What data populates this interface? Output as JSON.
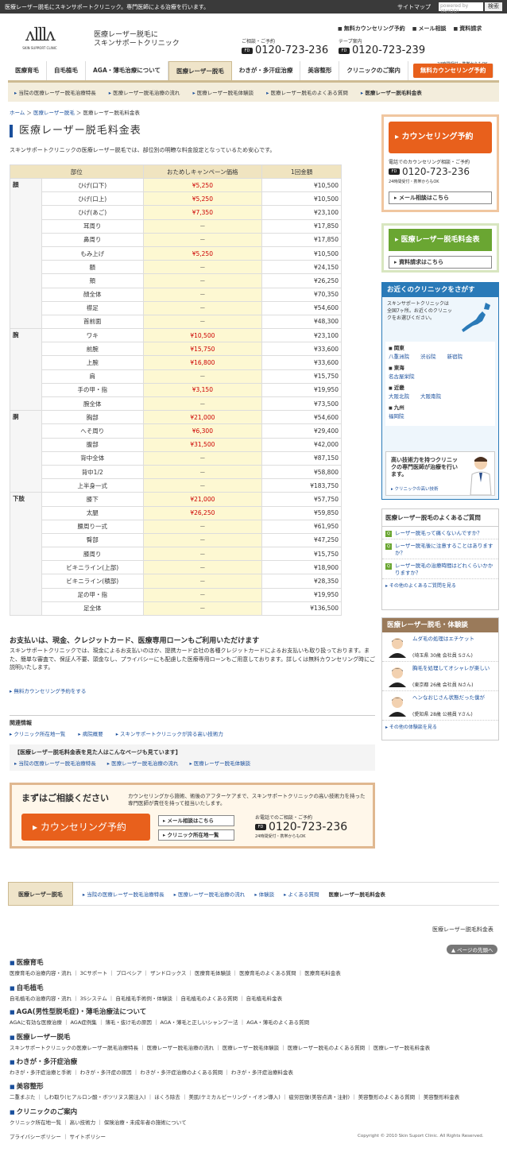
{
  "topbar": {
    "tagline": "医療レーザー脱毛にスキンサポートクリニック。専門医師による治療を行います。",
    "sitemap": "サイトマップ",
    "search_placeholder": "powered by YAHOO!",
    "search_btn": "検索"
  },
  "header": {
    "logo_sub": "SKIN SUPPORT CLINIC",
    "title_line1": "医療レーザー脱毛に",
    "title_line2": "スキンサポートクリニック",
    "links": [
      "無料カウンセリング予約",
      "メール相談",
      "資料請求"
    ],
    "phone1_label": "ご相談・ご予約",
    "phone1": "0120-723-236",
    "phone2_label": "テープ案内",
    "phone2": "0120-723-239",
    "hours": "24時間受付・携帯からもOK",
    "freedial": "FD"
  },
  "gnav": [
    "医療育毛",
    "自毛植毛",
    "AGA・薄毛治療について",
    "医療レーザー脱毛",
    "わきが・多汗症治療",
    "美容整形",
    "クリニックのご案内"
  ],
  "gnav_cta": "無料カウンセリング予約",
  "subnav": [
    "当院の医療レーザー脱毛治療特長",
    "医療レーザー脱毛治療の流れ",
    "医療レーザー脱毛体験談",
    "医療レーザー脱毛のよくある質問",
    "医療レーザー脱毛料金表"
  ],
  "breadcrumb": {
    "home": "ホーム",
    "parent": "医療レーザー脱毛",
    "current": "医療レーザー脱毛料金表"
  },
  "page_title": "医療レーザー脱毛料金表",
  "intro": "スキンサポートクリニックの医療レーザー脱毛では、部位別の明瞭な料金設定となっているため安心です。",
  "table": {
    "headers": [
      "部位",
      "おためしキャンペーン価格",
      "1回金額"
    ],
    "groups": [
      {
        "cat": "顔",
        "rows": [
          [
            "ひげ(口下)",
            "¥5,250",
            "¥10,500"
          ],
          [
            "ひげ(口上)",
            "¥5,250",
            "¥10,500"
          ],
          [
            "ひげ(あご)",
            "¥7,350",
            "¥23,100"
          ],
          [
            "耳周り",
            "－",
            "¥17,850"
          ],
          [
            "鼻周り",
            "－",
            "¥17,850"
          ],
          [
            "もみ上げ",
            "¥5,250",
            "¥10,500"
          ],
          [
            "額",
            "－",
            "¥24,150"
          ],
          [
            "頬",
            "－",
            "¥26,250"
          ],
          [
            "顔全体",
            "－",
            "¥70,350"
          ],
          [
            "襟足",
            "－",
            "¥54,600"
          ],
          [
            "首前面",
            "－",
            "¥48,300"
          ]
        ]
      },
      {
        "cat": "腕",
        "rows": [
          [
            "ワキ",
            "¥10,500",
            "¥23,100"
          ],
          [
            "前腕",
            "¥15,750",
            "¥33,600"
          ],
          [
            "上腕",
            "¥16,800",
            "¥33,600"
          ],
          [
            "肩",
            "－",
            "¥15,750"
          ],
          [
            "手の甲・指",
            "¥3,150",
            "¥19,950"
          ],
          [
            "腕全体",
            "－",
            "¥73,500"
          ]
        ]
      },
      {
        "cat": "胴",
        "rows": [
          [
            "胸部",
            "¥21,000",
            "¥54,600"
          ],
          [
            "へそ周り",
            "¥6,300",
            "¥29,400"
          ],
          [
            "腹部",
            "¥31,500",
            "¥42,000"
          ],
          [
            "背中全体",
            "－",
            "¥87,150"
          ],
          [
            "背中1/2",
            "－",
            "¥58,800"
          ],
          [
            "上半身一式",
            "－",
            "¥183,750"
          ]
        ]
      },
      {
        "cat": "下肢",
        "rows": [
          [
            "膝下",
            "¥21,000",
            "¥57,750"
          ],
          [
            "太腿",
            "¥26,250",
            "¥59,850"
          ],
          [
            "腰周り一式",
            "－",
            "¥61,950"
          ],
          [
            "臀部",
            "－",
            "¥47,250"
          ],
          [
            "膝周り",
            "－",
            "¥15,750"
          ],
          [
            "ビキニライン(上部)",
            "－",
            "¥18,900"
          ],
          [
            "ビキニライン(積部)",
            "－",
            "¥28,350"
          ],
          [
            "足の甲・指",
            "－",
            "¥19,950"
          ],
          [
            "足全体",
            "－",
            "¥136,500"
          ]
        ]
      }
    ]
  },
  "payment": {
    "heading": "お支払いは、現金、クレジットカード、医療専用ローンもご利用いただけます",
    "text": "スキンサポートクリニックでは、現金によるお支払いのほか、提携カード会社の各種クレジットカードによるお支払いも取り扱っております。また、簡単な審査で、保証人不要、頭金なし、プライバシーにも配慮した医療専用ローンもご用意しております。詳しくは無料カウンセリング時にご説明いたします。",
    "link": "無料カウンセリング予約をする"
  },
  "related": {
    "title": "関連情報",
    "links": [
      "クリニック所在地一覧",
      "病院概要",
      "スキンサポートクリニックが誇る高い技術力"
    ]
  },
  "related2": {
    "title": "【医療レーザー脱毛料金表を見た人はこんなページも見ています】",
    "links": [
      "当院の医療レーザー脱毛治療特長",
      "医療レーザー脱毛治療の流れ",
      "医療レーザー脱毛体験談"
    ]
  },
  "consult": {
    "heading": "まずはご相談ください",
    "desc": "カウンセリングから施術、術後のアフターケアまで、スキンサポートクリニックの高い技術力を持った専門医師が責任を持って担当いたします。",
    "btn": "カウンセリング予約",
    "mail": "メール相談はこちら",
    "clinics": "クリニック所在地一覧",
    "phone_label": "お電話でのご相談・ご予約",
    "phone": "0120-723-236",
    "hours": "24時間受付・携帯からもOK"
  },
  "side1": {
    "btn": "カウンセリング予約",
    "label": "電話でのカウンセリング相談・ご予約",
    "phone": "0120-723-236",
    "hours": "24時間受付・携帯からもOK",
    "mail": "メール相談はこちら"
  },
  "side2": {
    "btn": "医療レーザー脱毛料金表",
    "sub": "資料請求はこちら"
  },
  "side3": {
    "title": "お近くのクリニックをさがす",
    "intro": "スキンサポートクリニックは全国7ヶ所。お近くのクリニックをお選びください。",
    "regions": [
      {
        "name": "関東",
        "clinics": [
          "八重洲院",
          "渋谷院",
          "新宿院"
        ]
      },
      {
        "name": "東海",
        "clinics": [
          "名古屋栄院"
        ]
      },
      {
        "name": "近畿",
        "clinics": [
          "大阪北院",
          "大阪南院"
        ]
      },
      {
        "name": "九州",
        "clinics": [
          "福岡院"
        ]
      }
    ],
    "tech_text": "高い技術力を持つクリニックの専門医師が治療を行います。",
    "tech_link": "クリニックの高い技術"
  },
  "side4": {
    "title": "医療レーザー脱毛のよくあるご質問",
    "qs": [
      "レーザー脱毛って痛くないんですか？",
      "レーザー脱毛後に注意することはありますか？",
      "レーザー脱毛の治療時間はどれくらいかかりますか？"
    ],
    "more": "その他のよくあるご質問を見る"
  },
  "side5": {
    "title": "医療レーザー脱毛・体験談",
    "voices": [
      {
        "t": "ムダ毛の処理はエチケット",
        "w": "(埼玉県 30歳 会社員 Sさん)"
      },
      {
        "t": "胸毛を処理してオシャレが楽しい",
        "w": "(東京都 26歳 会社員 Nさん)"
      },
      {
        "t": "ヘンなおじさん状態だった僕が",
        "w": "(愛知県 28歳 公務員 Yさん)"
      }
    ],
    "more": "その他の体験談を見る"
  },
  "bnav": {
    "tab": "医療レーザー脱毛",
    "items": [
      "当院の医療レーザー脱毛治療特長",
      "医療レーザー脱毛治療の流れ",
      "体験談",
      "よくある質問",
      "医療レーザー脱毛料金表"
    ]
  },
  "footer": {
    "title": "医療レーザー脱毛料金表",
    "totop": "ページの先頭へ",
    "sections": [
      {
        "h": "医療育毛",
        "l": "医療育毛の治療内容・流れ ｜ 3Cサポート ｜ プロペシア ｜ ザンドロックス ｜ 医療育毛体験談 ｜ 医療育毛のよくある質問 ｜ 医療育毛料金表"
      },
      {
        "h": "自毛植毛",
        "l": "自毛植毛の治療内容・流れ ｜ 3Sシステム ｜ 自毛植毛手術例・体験談 ｜ 自毛植毛のよくある質問 ｜ 自毛植毛料金表"
      },
      {
        "h": "AGA(男性型脱毛症)・薄毛治療法について",
        "l": "AGAに有効な医療治療 ｜ AGA症例集 ｜ 薄毛・抜け毛の原因 ｜ AGA・薄毛と正しいシャンプー法 ｜ AGA・薄毛のよくある質問"
      },
      {
        "h": "医療レーザー脱毛",
        "l": "スキンサポートクリニックの医療レーザー脱毛治療特長 ｜ 医療レーザー脱毛治療の流れ ｜ 医療レーザー脱毛体験談 ｜ 医療レーザー脱毛のよくある質問 ｜ 医療レーザー脱毛料金表"
      },
      {
        "h": "わきが・多汗症治療",
        "l": "わきが・多汗症治療と手術 ｜ わきが・多汗症の原因 ｜ わきが・多汗症治療のよくある質問 ｜ わきが・多汗症治療料金表"
      },
      {
        "h": "美容整形",
        "l": "二重まぶた ｜ しわ取り(ヒアルロン酸・ボツリヌス菌注入) ｜ ほくろ除去 ｜ 美肌(ケミカルピーリング・イオン導入) ｜ 疲労回復(美容点滴・注射) ｜ 美容整形のよくある質問 ｜ 美容整形料金表"
      },
      {
        "h": "クリニックのご案内",
        "l": "クリニック所在地一覧 ｜ 高い技術力 ｜ 保険治療・未成年者の施術について"
      }
    ],
    "bottom": "プライバシーポリシー ｜ サイトポリシー",
    "copyright": "Copyright © 2010 Skin Suport Clinic. All Rights Reserved."
  }
}
